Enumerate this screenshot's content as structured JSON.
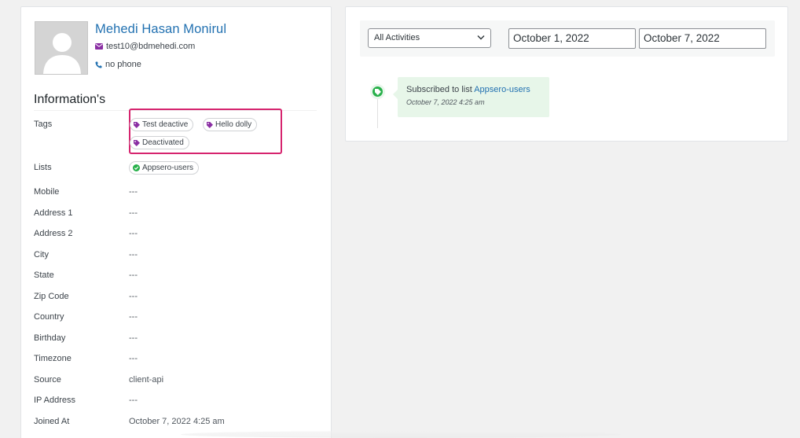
{
  "contact": {
    "name": "Mehedi Hasan Monirul",
    "email": "test10@bdmehedi.com",
    "phone": "no phone",
    "avatar_icon": "user-silhouette-icon"
  },
  "information": {
    "title": "Information's",
    "tags_label": "Tags",
    "tags": [
      "Test deactive",
      "Hello dolly",
      "Deactivated"
    ],
    "lists_label": "Lists",
    "lists": [
      "Appsero-users"
    ],
    "fields": [
      {
        "label": "Mobile",
        "value": "---"
      },
      {
        "label": "Address 1",
        "value": "---"
      },
      {
        "label": "Address 2",
        "value": "---"
      },
      {
        "label": "City",
        "value": "---"
      },
      {
        "label": "State",
        "value": "---"
      },
      {
        "label": "Zip Code",
        "value": "---"
      },
      {
        "label": "Country",
        "value": "---"
      },
      {
        "label": "Birthday",
        "value": "---"
      },
      {
        "label": "Timezone",
        "value": "---"
      },
      {
        "label": "Source",
        "value": "client-api"
      },
      {
        "label": "IP Address",
        "value": "---"
      },
      {
        "label": "Joined At",
        "value": "October 7, 2022 4:25 am"
      }
    ]
  },
  "activities": {
    "filter_selected": "All Activities",
    "date_from": "October 1, 2022",
    "date_to": "October 7, 2022",
    "items": [
      {
        "text": "Subscribed to list",
        "link": "Appsero-users",
        "time": "October 7, 2022 4:25 am"
      }
    ]
  },
  "colors": {
    "link": "#2271b1",
    "tag_icon": "#8a2ea3",
    "highlight_box": "#d6246e",
    "success": "#27b04a",
    "activity_bg": "#e7f6e9"
  }
}
